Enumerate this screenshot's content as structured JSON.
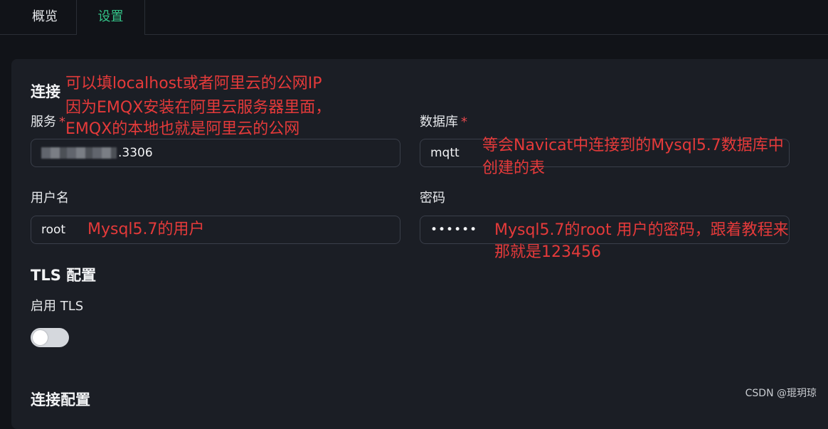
{
  "tabs": {
    "overview": "概览",
    "settings": "设置"
  },
  "sections": {
    "connection": "连接",
    "tls": "TLS 配置",
    "connection_config": "连接配置"
  },
  "fields": {
    "server": {
      "label": "服务",
      "required_mark": "*",
      "value_suffix": ".3306"
    },
    "database": {
      "label": "数据库",
      "required_mark": "*",
      "value": "mqtt"
    },
    "username": {
      "label": "用户名",
      "value": "root"
    },
    "password": {
      "label": "密码",
      "value": "••••••"
    }
  },
  "tls": {
    "enable_label": "启用 TLS",
    "enabled": false
  },
  "annotations": {
    "server_line1": "可以填localhost或者阿里云的公网IP",
    "server_line2": "因为EMQX安装在阿里云服务器里面，",
    "server_line3": "EMQX的本地也就是阿里云的公网",
    "database_line1": "等会Navicat中连接到的Mysql5.7数据库中",
    "database_line2": "创建的表",
    "username": "Mysql5.7的用户",
    "password_line1": "Mysql5.7的root 用户的密码，跟着教程来",
    "password_line2": "那就是123456"
  },
  "watermark": "CSDN @琨玥琼",
  "colors": {
    "accent": "#34c388",
    "annotation": "#e53a3a",
    "background": "#111318",
    "card": "#1b1e25"
  }
}
